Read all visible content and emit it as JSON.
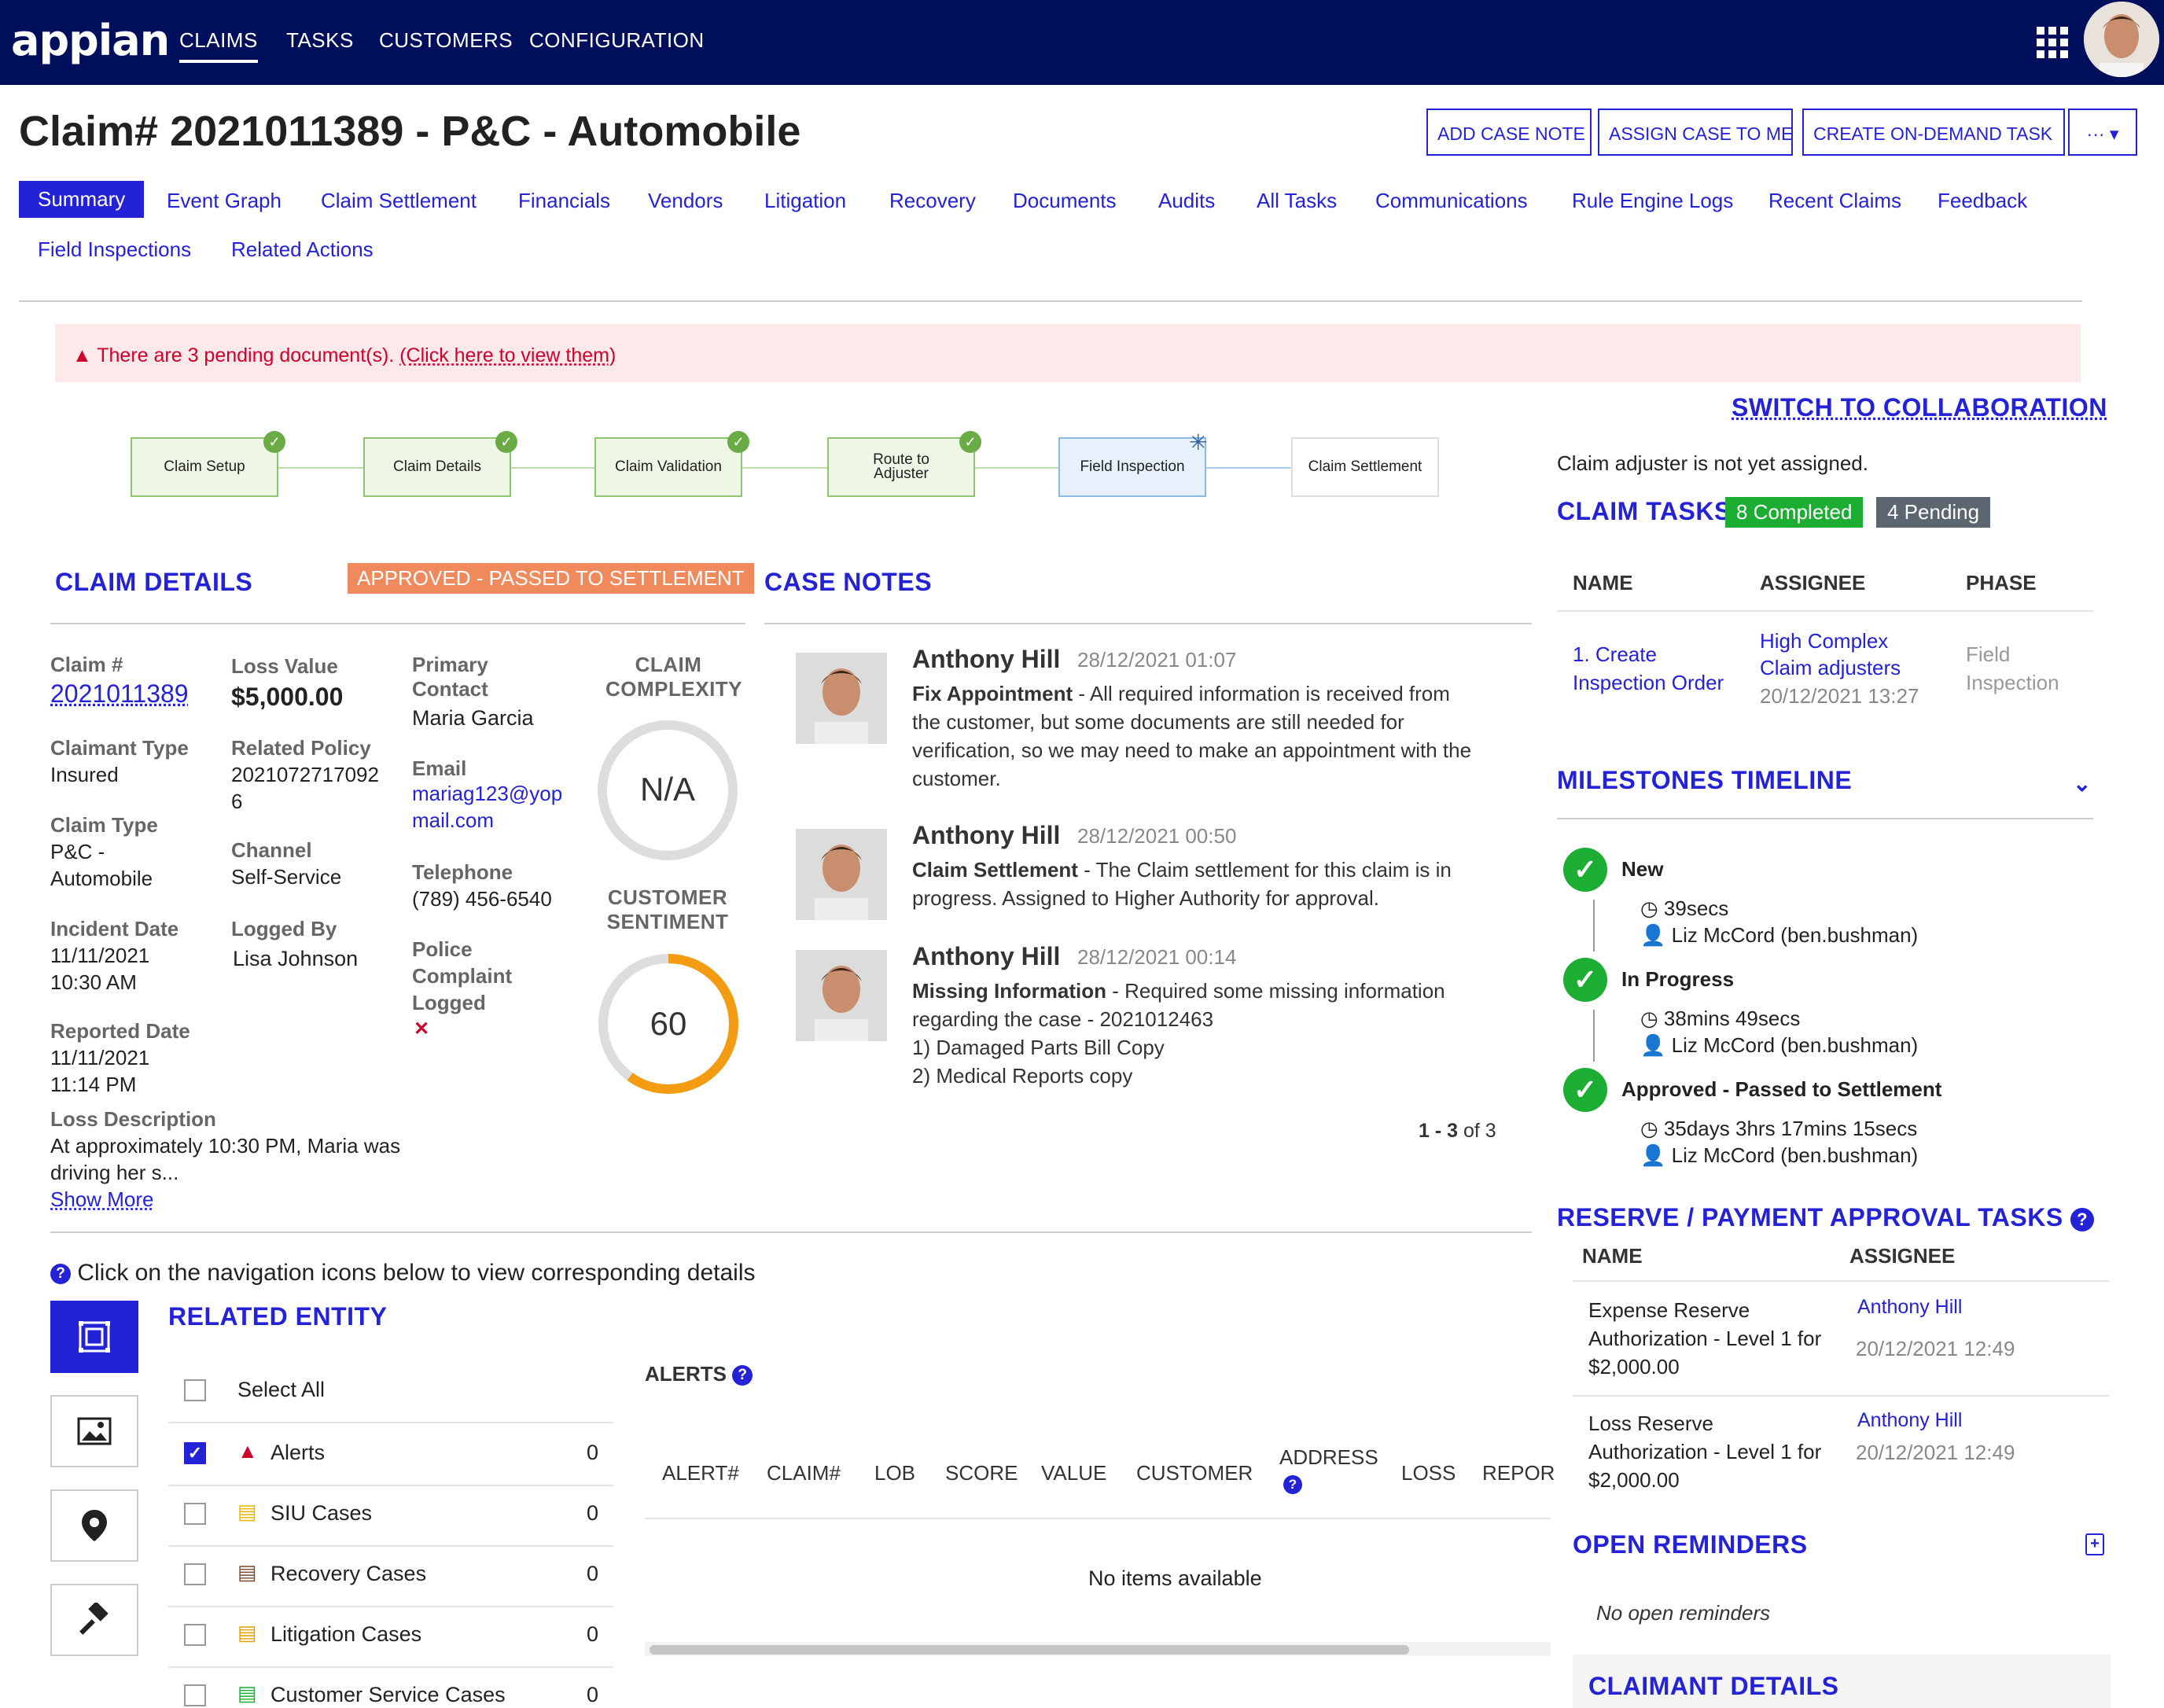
{
  "nav": {
    "logo": "appian",
    "items": [
      "CLAIMS",
      "TASKS",
      "CUSTOMERS",
      "CONFIGURATION"
    ],
    "active": "CLAIMS"
  },
  "header": {
    "title": "Claim# 2021011389 - P&C - Automobile",
    "buttons": {
      "add_note": "ADD CASE NOTE",
      "assign": "ASSIGN CASE TO ME",
      "create_task": "CREATE ON-DEMAND TASK",
      "more": "··· ▾"
    }
  },
  "tabs": [
    "Summary",
    "Event Graph",
    "Claim Settlement",
    "Financials",
    "Vendors",
    "Litigation",
    "Recovery",
    "Documents",
    "Audits",
    "All Tasks",
    "Communications",
    "Rule Engine Logs",
    "Recent Claims",
    "Feedback",
    "Field Inspections",
    "Related Actions"
  ],
  "banner": {
    "text": "There are 3 pending document(s).",
    "link": "(Click here to view them)"
  },
  "process": {
    "steps": [
      "Claim Setup",
      "Claim Details",
      "Claim Validation",
      "Route to Adjuster",
      "Field Inspection",
      "Claim Settlement"
    ],
    "completed": 4,
    "current": 4
  },
  "claim_details": {
    "heading": "CLAIM DETAILS",
    "status": "APPROVED - PASSED TO SETTLEMENT",
    "claim_no_label": "Claim #",
    "claim_no": "2021011389",
    "loss_value_label": "Loss Value",
    "loss_value": "$5,000.00",
    "primary_contact_label": "Primary Contact",
    "primary_contact": "Maria Garcia",
    "claimant_type_label": "Claimant Type",
    "claimant_type": "Insured",
    "related_policy_label": "Related Policy",
    "related_policy_1": "2021072717092",
    "related_policy_2": "6",
    "email_label": "Email",
    "email_1": "mariag123@yop",
    "email_2": "mail.com",
    "claim_type_label": "Claim Type",
    "claim_type_1": "P&C -",
    "claim_type_2": "Automobile",
    "channel_label": "Channel",
    "channel": "Self-Service",
    "telephone_label": "Telephone",
    "telephone": "(789) 456-6540",
    "incident_date_label": "Incident Date",
    "incident_date_1": "11/11/2021",
    "incident_date_2": "10:30 AM",
    "logged_by_label": "Logged By",
    "logged_by": "Lisa Johnson",
    "police_label_1": "Police",
    "police_label_2": "Complaint",
    "police_label_3": "Logged",
    "police_value": "✕",
    "reported_date_label": "Reported Date",
    "reported_date_1": "11/11/2021",
    "reported_date_2": "11:14 PM",
    "loss_desc_label": "Loss Description",
    "loss_desc_1": "At approximately 10:30 PM, Maria was",
    "loss_desc_2": "driving her s...",
    "show_more": "Show More",
    "complexity_label_1": "CLAIM",
    "complexity_label_2": "COMPLEXITY",
    "complexity_value": "N/A",
    "sentiment_label_1": "CUSTOMER",
    "sentiment_label_2": "SENTIMENT",
    "sentiment_value": "60",
    "sentiment_fraction": 0.6
  },
  "case_notes": {
    "heading": "CASE NOTES",
    "notes": [
      {
        "author": "Anthony Hill",
        "date": "28/12/2021 01:07",
        "title": "Fix Appointment",
        "lines": [
          "- All required information is received from",
          "the customer, but some documents are still needed for",
          "verification, so we may need to make an appointment with the",
          "customer."
        ]
      },
      {
        "author": "Anthony Hill",
        "date": "28/12/2021 00:50",
        "title": "Claim Settlement",
        "lines": [
          "- The Claim settlement for this claim is in",
          "progress. Assigned to Higher Authority for approval."
        ]
      },
      {
        "author": "Anthony Hill",
        "date": "28/12/2021 00:14",
        "title": "Missing Information",
        "lines": [
          "- Required some missing information",
          "regarding the case - 2021012463",
          "1) Damaged Parts Bill Copy",
          "2) Medical Reports copy"
        ]
      }
    ],
    "pager_range": "1 - 3",
    "pager_total": "of 3"
  },
  "right": {
    "switch": "SWITCH TO COLLABORATION",
    "adjuster_note": "Claim adjuster is not yet assigned.",
    "claim_tasks": "CLAIM TASKS",
    "completed": "8 Completed",
    "pending": "4 Pending",
    "task_cols": [
      "NAME",
      "ASSIGNEE",
      "PHASE"
    ],
    "task": {
      "name_1": "1. Create",
      "name_2": "Inspection Order",
      "assignee_1": "High Complex",
      "assignee_2": "Claim adjusters",
      "assignee_date": "20/12/2021 13:27",
      "phase_1": "Field",
      "phase_2": "Inspection"
    },
    "milestones_heading": "MILESTONES TIMELINE",
    "milestones": [
      {
        "name": "New",
        "duration": "39secs",
        "user": "Liz McCord (ben.bushman)"
      },
      {
        "name": "In Progress",
        "duration": "38mins 49secs",
        "user": "Liz McCord (ben.bushman)"
      },
      {
        "name": "Approved - Passed to Settlement",
        "duration": "35days 3hrs 17mins 15secs",
        "user": "Liz McCord (ben.bushman)"
      }
    ],
    "reserve_heading": "RESERVE / PAYMENT APPROVAL TASKS",
    "reserve_cols": [
      "NAME",
      "ASSIGNEE"
    ],
    "reserve_tasks": [
      {
        "name_1": "Expense Reserve",
        "name_2": "Authorization - Level 1 for",
        "name_3": "$2,000.00",
        "assignee": "Anthony Hill",
        "date": "20/12/2021 12:49"
      },
      {
        "name_1": "Loss Reserve",
        "name_2": "Authorization - Level 1 for",
        "name_3": "$2,000.00",
        "assignee": "Anthony Hill",
        "date": "20/12/2021 12:49"
      }
    ],
    "reminders_heading": "OPEN REMINDERS",
    "no_reminders": "No open reminders",
    "claimant_heading": "CLAIMANT DETAILS"
  },
  "related": {
    "hint": "Click on the navigation icons below to view corresponding details",
    "heading": "RELATED ENTITY",
    "select_all": "Select All",
    "rows": [
      {
        "label": "Alerts",
        "count": "0",
        "checked": true
      },
      {
        "label": "SIU Cases",
        "count": "0",
        "checked": false
      },
      {
        "label": "Recovery Cases",
        "count": "0",
        "checked": false
      },
      {
        "label": "Litigation Cases",
        "count": "0",
        "checked": false
      },
      {
        "label": "Customer Service Cases",
        "count": "0",
        "checked": false
      }
    ],
    "alerts_heading": "ALERTS",
    "alert_cols": [
      "ALERT#",
      "CLAIM#",
      "LOB",
      "SCORE",
      "VALUE",
      "CUSTOMER",
      "ADDRESS",
      "LOSS",
      "REPOR"
    ],
    "empty": "No items available"
  }
}
